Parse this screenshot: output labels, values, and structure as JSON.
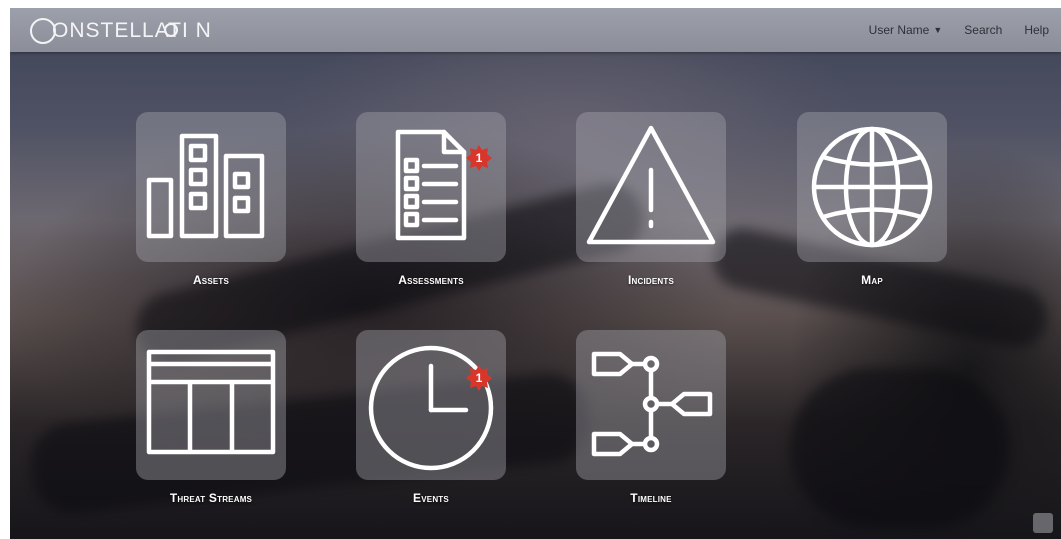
{
  "app": {
    "brand": "ONSTELLATI N"
  },
  "nav": {
    "user": "User Name",
    "search": "Search",
    "help": "Help"
  },
  "tiles": [
    {
      "label": "Assets",
      "icon": "buildings-icon"
    },
    {
      "label": "Assessments",
      "icon": "checklist-document-icon",
      "badge": "1"
    },
    {
      "label": "Incidents",
      "icon": "warning-triangle-icon"
    },
    {
      "label": "Map",
      "icon": "globe-icon"
    },
    {
      "label": "Threat Streams",
      "icon": "table-layout-icon"
    },
    {
      "label": "Events",
      "icon": "clock-icon",
      "badge": "1"
    },
    {
      "label": "Timeline",
      "icon": "timeline-branch-icon"
    }
  ],
  "colors": {
    "badge": "#d9362b",
    "topbar": "#9a9da8",
    "tile": "#a5a5ac"
  }
}
